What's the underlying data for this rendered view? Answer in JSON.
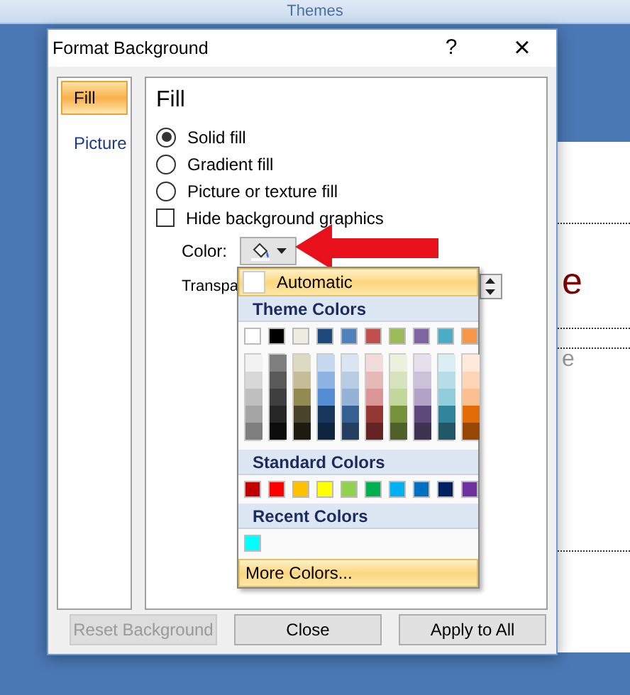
{
  "ribbon": {
    "label": "Themes"
  },
  "slide": {
    "texts": [
      {
        "text": "e",
        "kind": "title"
      },
      {
        "text": "e",
        "kind": "body"
      }
    ]
  },
  "dialog": {
    "title": "Format Background",
    "help": "?",
    "close": "×",
    "categories": [
      {
        "label": "Fill",
        "selected": true
      },
      {
        "label": "Picture",
        "selected": false
      }
    ],
    "heading": "Fill",
    "options": [
      {
        "kind": "radio",
        "label": "Solid fill",
        "checked": true
      },
      {
        "kind": "radio",
        "label": "Gradient fill",
        "checked": false
      },
      {
        "kind": "radio",
        "label": "Picture or texture fill",
        "checked": false
      },
      {
        "kind": "checkbox",
        "label": "Hide background graphics",
        "checked": false
      }
    ],
    "color_label": "Color:",
    "transparency_label": "Transpa",
    "buttons": [
      {
        "label": "Reset Background",
        "disabled": true
      },
      {
        "label": "Close",
        "disabled": false
      },
      {
        "label": "Apply to All",
        "disabled": false
      }
    ]
  },
  "color_menu": {
    "automatic": "Automatic",
    "theme_header": "Theme Colors",
    "theme_colors": [
      {
        "color": "#ffffff",
        "shades": [
          {
            "color": "#f2f2f2"
          },
          {
            "color": "#d8d8d8"
          },
          {
            "color": "#bfbfbf"
          },
          {
            "color": "#a5a5a5"
          },
          {
            "color": "#7f7f7f"
          }
        ]
      },
      {
        "color": "#000000",
        "shades": [
          {
            "color": "#7f7f7f"
          },
          {
            "color": "#595959"
          },
          {
            "color": "#3f3f3f"
          },
          {
            "color": "#262626"
          },
          {
            "color": "#0c0c0c"
          }
        ]
      },
      {
        "color": "#eeece1",
        "shades": [
          {
            "color": "#ddd9c3"
          },
          {
            "color": "#c4bd97"
          },
          {
            "color": "#938953"
          },
          {
            "color": "#494429"
          },
          {
            "color": "#1d1b10"
          }
        ]
      },
      {
        "color": "#1f497d",
        "shades": [
          {
            "color": "#c6d9f0"
          },
          {
            "color": "#8db3e2"
          },
          {
            "color": "#548dd4"
          },
          {
            "color": "#17365d"
          },
          {
            "color": "#0f243e"
          }
        ]
      },
      {
        "color": "#4f81bd",
        "shades": [
          {
            "color": "#dbe5f1"
          },
          {
            "color": "#b8cce4"
          },
          {
            "color": "#95b3d7"
          },
          {
            "color": "#366092"
          },
          {
            "color": "#244061"
          }
        ]
      },
      {
        "color": "#c0504d",
        "shades": [
          {
            "color": "#f2dcdb"
          },
          {
            "color": "#e5b9b7"
          },
          {
            "color": "#d99694"
          },
          {
            "color": "#953734"
          },
          {
            "color": "#632423"
          }
        ]
      },
      {
        "color": "#9bbb59",
        "shades": [
          {
            "color": "#ebf1dd"
          },
          {
            "color": "#d7e3bc"
          },
          {
            "color": "#c3d69b"
          },
          {
            "color": "#76923c"
          },
          {
            "color": "#4f6128"
          }
        ]
      },
      {
        "color": "#8064a2",
        "shades": [
          {
            "color": "#e5e0ec"
          },
          {
            "color": "#ccc1d9"
          },
          {
            "color": "#b2a2c7"
          },
          {
            "color": "#5f497a"
          },
          {
            "color": "#3f3151"
          }
        ]
      },
      {
        "color": "#4bacc6",
        "shades": [
          {
            "color": "#dbeef3"
          },
          {
            "color": "#b7dde8"
          },
          {
            "color": "#92cddc"
          },
          {
            "color": "#31859b"
          },
          {
            "color": "#205867"
          }
        ]
      },
      {
        "color": "#f79646",
        "shades": [
          {
            "color": "#fdeada"
          },
          {
            "color": "#fbd5b5"
          },
          {
            "color": "#fac08f"
          },
          {
            "color": "#e36c09"
          },
          {
            "color": "#974806"
          }
        ]
      }
    ],
    "standard_header": "Standard Colors",
    "standard_colors": [
      {
        "color": "#c00000"
      },
      {
        "color": "#ff0000"
      },
      {
        "color": "#ffc000"
      },
      {
        "color": "#ffff00"
      },
      {
        "color": "#92d050"
      },
      {
        "color": "#00b050"
      },
      {
        "color": "#00b0f0"
      },
      {
        "color": "#0070c0"
      },
      {
        "color": "#002060"
      },
      {
        "color": "#7030a0"
      }
    ],
    "recent_header": "Recent Colors",
    "recent_colors": [
      {
        "color": "#00ffff"
      }
    ],
    "more": "More Colors..."
  }
}
